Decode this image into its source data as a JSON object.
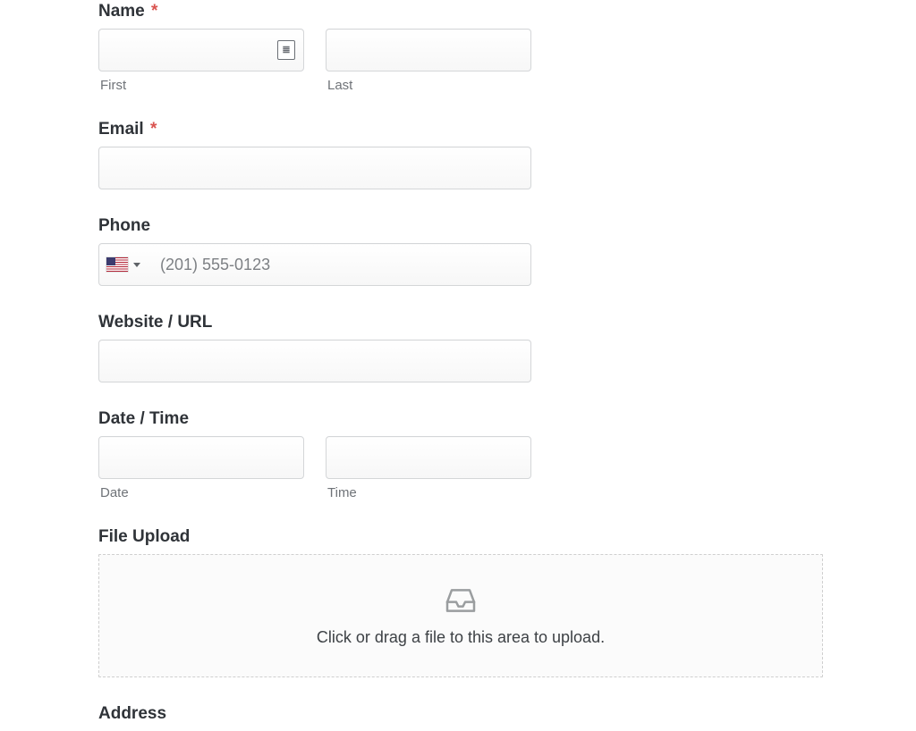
{
  "name": {
    "label": "Name",
    "required_mark": "*",
    "first_sub": "First",
    "last_sub": "Last"
  },
  "email": {
    "label": "Email",
    "required_mark": "*"
  },
  "phone": {
    "label": "Phone",
    "placeholder": "(201) 555-0123",
    "country": "us"
  },
  "website": {
    "label": "Website / URL"
  },
  "datetime": {
    "label": "Date / Time",
    "date_sub": "Date",
    "time_sub": "Time"
  },
  "file_upload": {
    "label": "File Upload",
    "dropzone_text": "Click or drag a file to this area to upload."
  },
  "address": {
    "label": "Address"
  }
}
